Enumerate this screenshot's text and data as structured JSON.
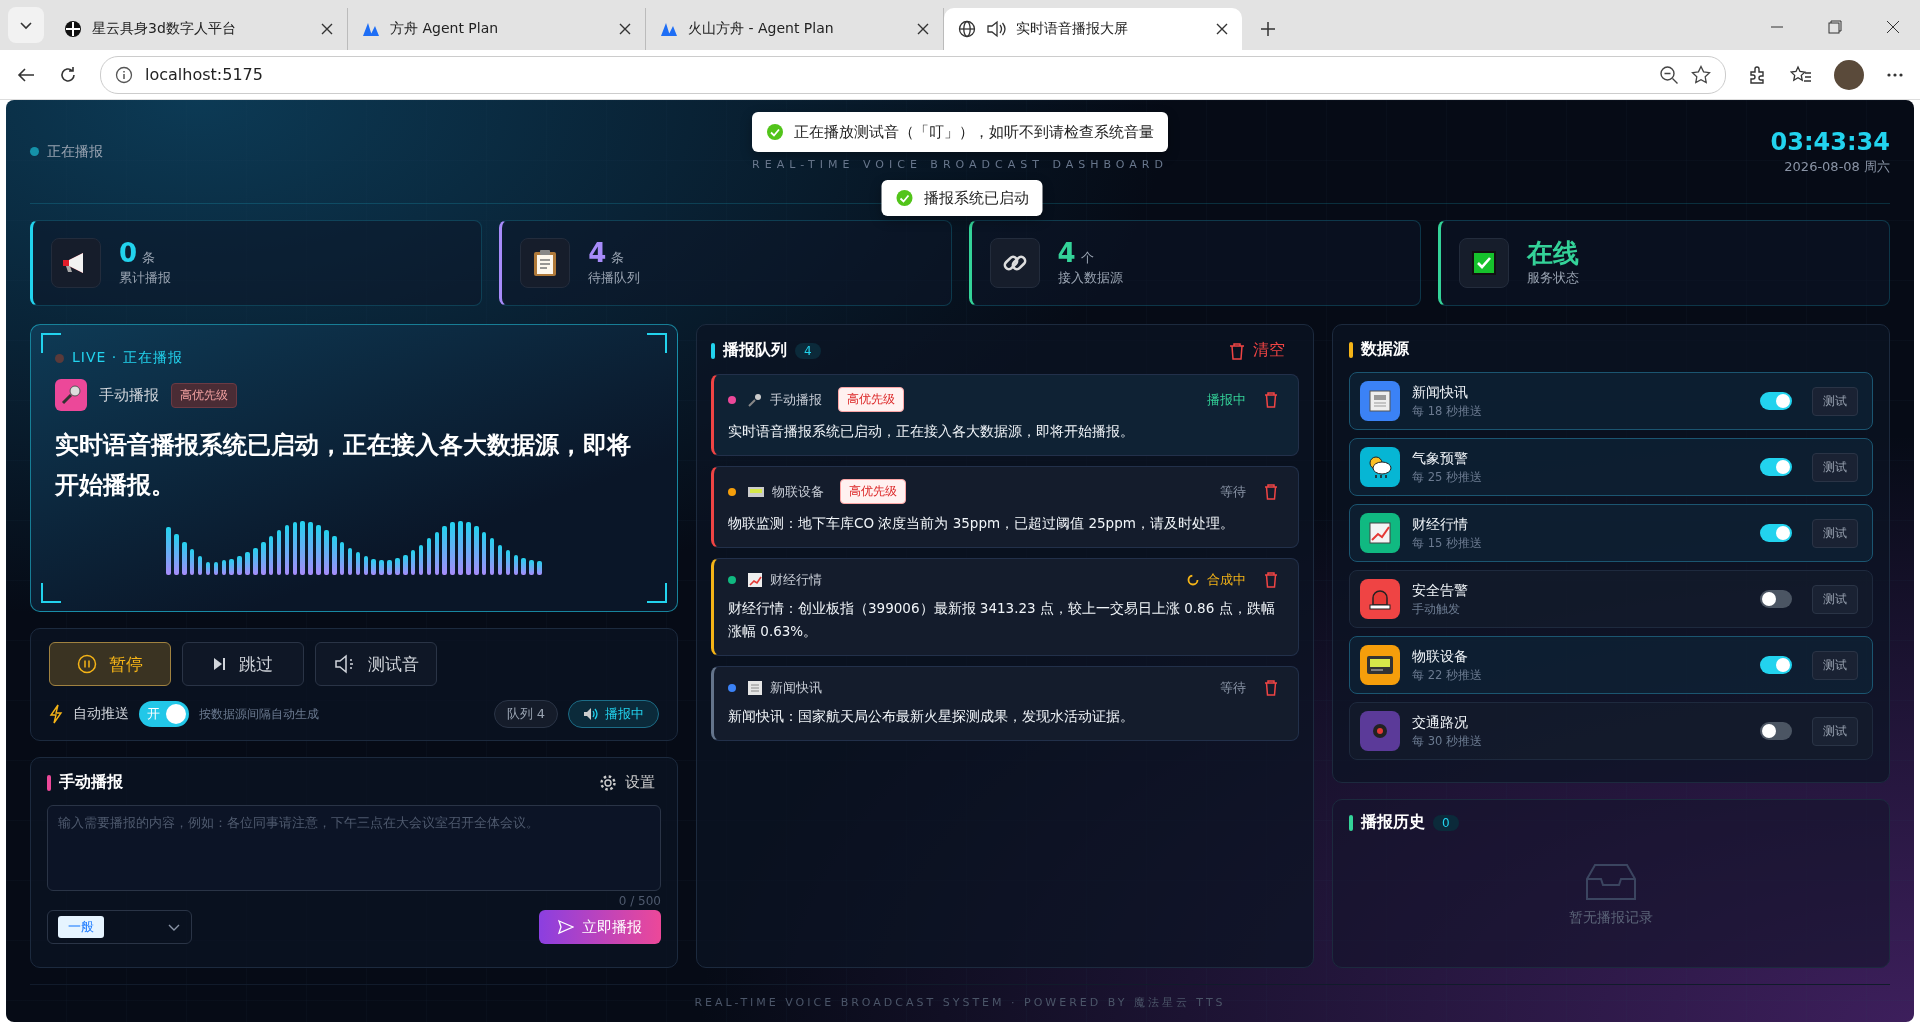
{
  "browser": {
    "tabs": [
      {
        "title": "星云具身3d数字人平台",
        "kind": "logo",
        "audio": false,
        "selected": false
      },
      {
        "title": "方舟 Agent Plan",
        "kind": "peak",
        "audio": false,
        "selected": false
      },
      {
        "title": "火山方舟 - Agent Plan",
        "kind": "peak",
        "audio": false,
        "selected": false
      },
      {
        "title": "实时语音播报大屏",
        "kind": "globe",
        "audio": true,
        "selected": true
      }
    ],
    "address": "localhost:5175"
  },
  "header": {
    "status": "正在播报",
    "subtitle": "REAL-TIME VOICE BROADCAST DASHBOARD",
    "time": "03:43:34",
    "date": "2026-08-08 周六"
  },
  "toasts": [
    "正在播放测试音（「叮」），如听不到请检查系统音量",
    "播报系统已启动"
  ],
  "stats": [
    {
      "kind": "megaphone",
      "value": "0",
      "unit": "条",
      "label": "累计播报",
      "color": "#22d3ee"
    },
    {
      "kind": "clipboard",
      "value": "4",
      "unit": "条",
      "label": "待播队列",
      "color": "#a78bfa"
    },
    {
      "kind": "link",
      "value": "4",
      "unit": "个",
      "label": "接入数据源",
      "color": "#34d399"
    },
    {
      "kind": "check",
      "value": "在线",
      "label": "服务状态",
      "color": "#34d399"
    }
  ],
  "live": {
    "tag": "LIVE · 正在播报",
    "source": "手动播报",
    "priority": "高优先级",
    "text": "实时语音播报系统已启动，正在接入各大数据源，即将开始播报。"
  },
  "controls": {
    "buttons": [
      {
        "kind": "pause",
        "label": "暂停",
        "selected": true
      },
      {
        "kind": "skip",
        "label": "跳过",
        "selected": false
      },
      {
        "kind": "test",
        "label": "测试音",
        "selected": false
      }
    ],
    "auto_push": {
      "label": "自动推送",
      "on": true,
      "switch_text": "开",
      "hint": "按数据源间隔自动生成"
    },
    "queue_badge": "队列 4",
    "playing_badge": "播报中"
  },
  "manual": {
    "title": "手动播报",
    "settings": "设置",
    "placeholder": "输入需要播报的内容，例如：各位同事请注意，下午三点在大会议室召开全体会议。",
    "counter": "0 / 500",
    "level": "一般",
    "submit": "立即播报"
  },
  "queue": {
    "title": "播报队列",
    "count": "4",
    "clear": "清空",
    "items": [
      {
        "kind": "mic",
        "source": "手动播报",
        "color": "#ec4899",
        "priority": "高优先级",
        "playing": true,
        "synthesizing": false,
        "status": "播报中",
        "text": "实时语音播报系统已启动，正在接入各大数据源，即将开始播报。"
      },
      {
        "kind": "device",
        "source": "物联设备",
        "color": "#f59e0b",
        "priority": "高优先级",
        "playing": false,
        "synthesizing": false,
        "status": "等待",
        "text": "物联监测：地下车库CO 浓度当前为 35ppm，已超过阈值 25ppm，请及时处理。"
      },
      {
        "kind": "chart",
        "source": "财经行情",
        "color": "#10b981",
        "playing": false,
        "synthesizing": true,
        "status": "合成中",
        "text": "财经行情：创业板指（399006）最新报 3413.23 点，较上一交易日上涨 0.86 点，跌幅涨幅 0.63%。"
      },
      {
        "kind": "news",
        "source": "新闻快讯",
        "color": "#3b82f6",
        "playing": false,
        "synthesizing": false,
        "status": "等待",
        "text": "新闻快讯：国家航天局公布最新火星探测成果，发现水活动证据。"
      }
    ]
  },
  "sources": {
    "title": "数据源",
    "items": [
      {
        "kind": "news",
        "name": "新闻快讯",
        "interval": "每 18 秒推送",
        "on": true,
        "color": "#3b82f6",
        "test": "测试"
      },
      {
        "kind": "weather",
        "name": "气象预警",
        "interval": "每 25 秒推送",
        "on": true,
        "color": "#06b6d4",
        "test": "测试"
      },
      {
        "kind": "chart",
        "name": "财经行情",
        "interval": "每 15 秒推送",
        "on": true,
        "color": "#10b981",
        "test": "测试"
      },
      {
        "kind": "siren",
        "name": "安全告警",
        "interval": "手动触发",
        "on": false,
        "color": "#ef4444",
        "test": "测试"
      },
      {
        "kind": "device",
        "name": "物联设备",
        "interval": "每 22 秒推送",
        "on": true,
        "color": "#f59e0b",
        "test": "测试"
      },
      {
        "kind": "traffic",
        "name": "交通路况",
        "interval": "每 30 秒推送",
        "on": false,
        "color": "#5b3a99",
        "test": "测试"
      }
    ]
  },
  "history": {
    "title": "播报历史",
    "count": "0",
    "empty": "暂无播报记录"
  },
  "footer": "REAL-TIME VOICE BROADCAST SYSTEM · POWERED BY 魔法星云 TTS"
}
